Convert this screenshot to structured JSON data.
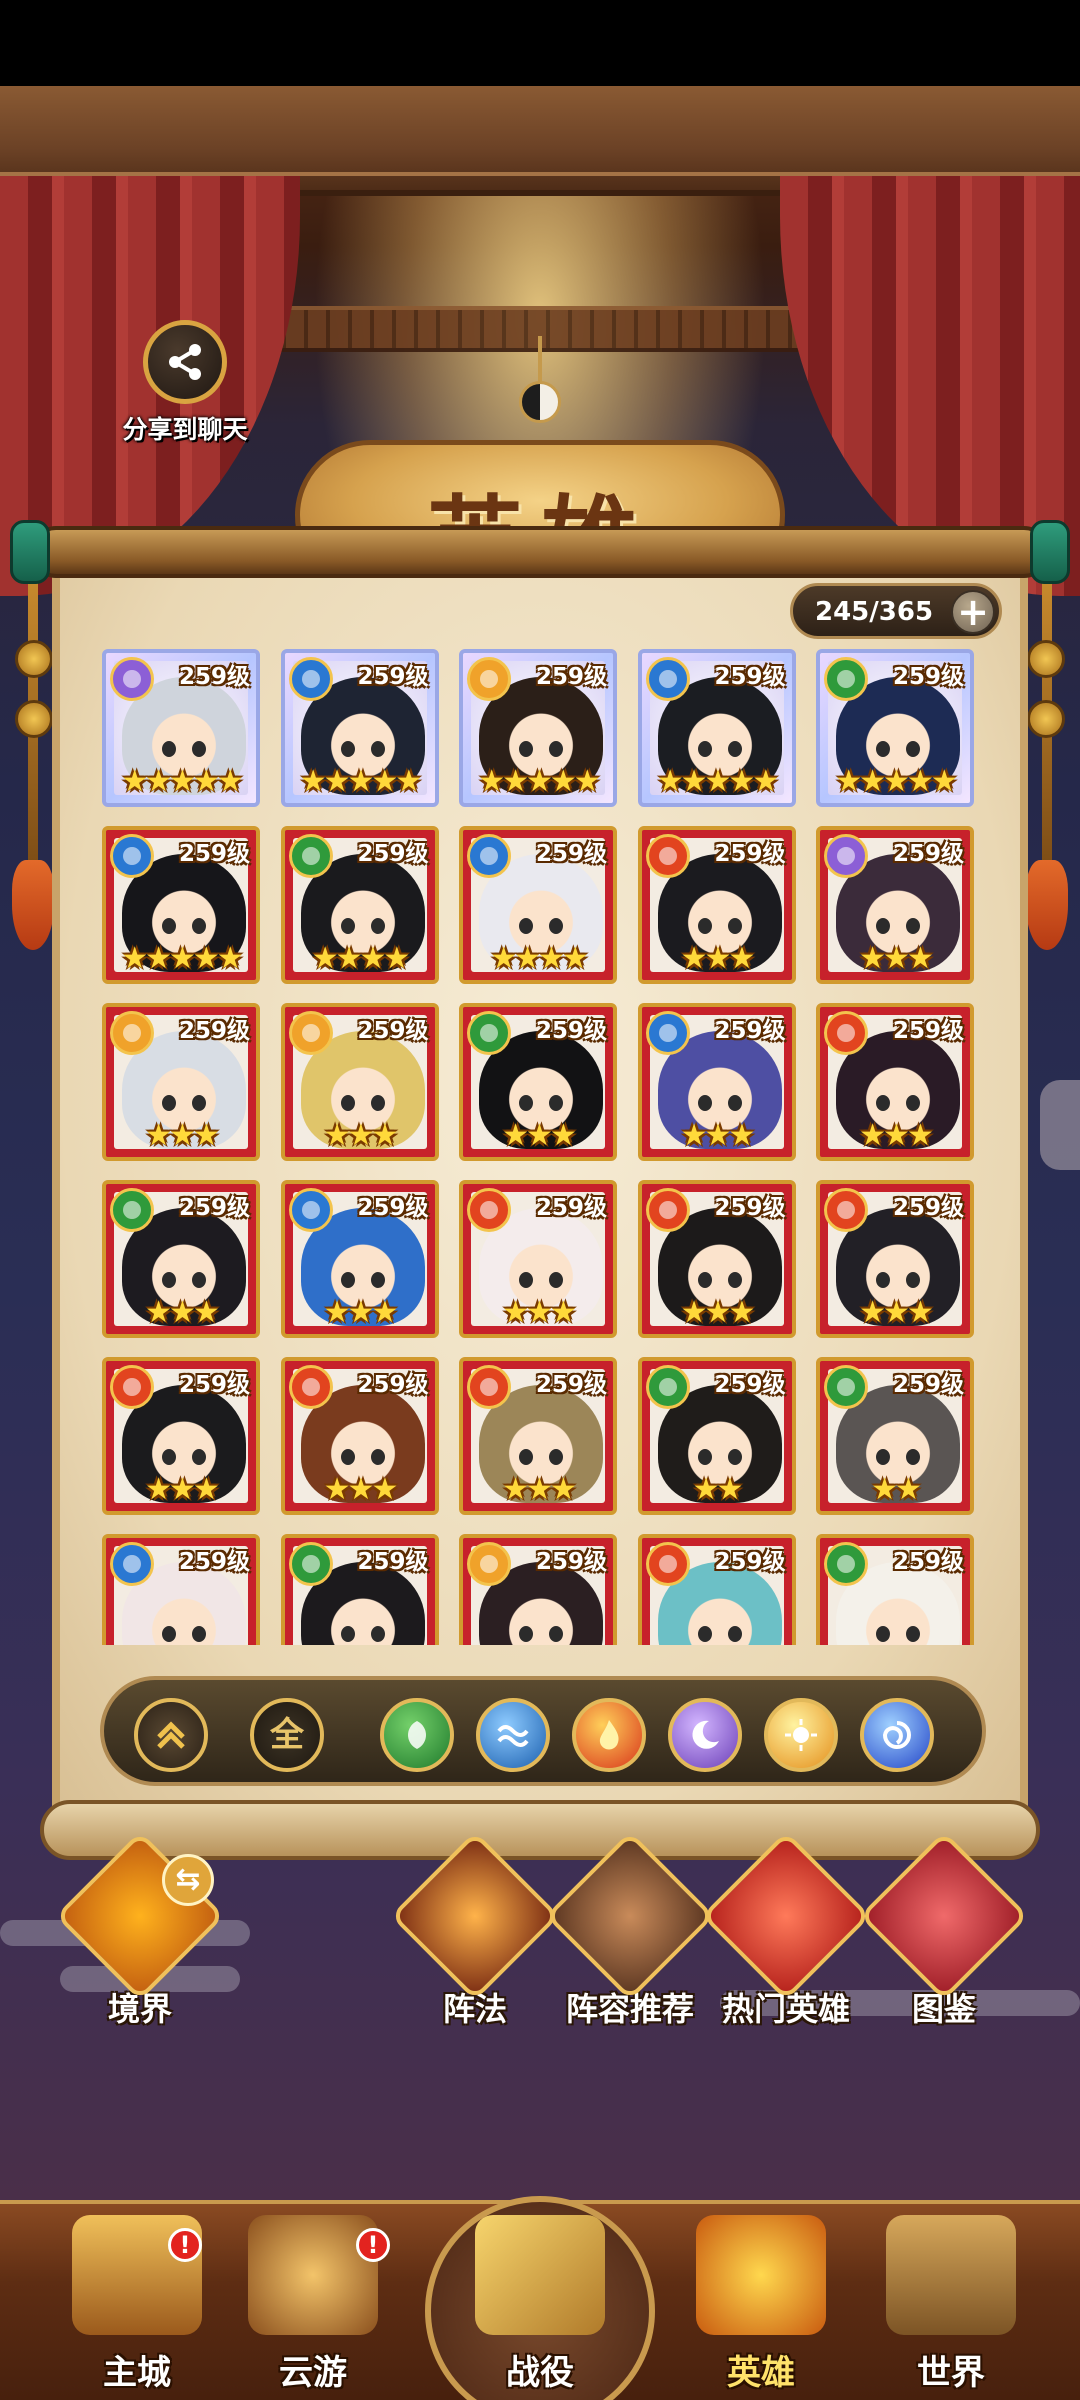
{
  "share": {
    "label": "分享到聊天",
    "icon": "share-icon"
  },
  "title": "英雄",
  "hero_count": {
    "text": "245/365",
    "plus": "+"
  },
  "hero_grid": {
    "level_text": "259级",
    "cards": [
      {
        "frame": "purple",
        "element": "dark",
        "stars": "★★★★★",
        "hair": "#cfd4dc"
      },
      {
        "frame": "purple",
        "element": "water",
        "stars": "★★★★★",
        "hair": "#1e2433"
      },
      {
        "frame": "purple",
        "element": "light",
        "stars": "★★★★★",
        "hair": "#2b1f18"
      },
      {
        "frame": "purple",
        "element": "water",
        "stars": "★★★★★",
        "hair": "#1b1d22"
      },
      {
        "frame": "purple",
        "element": "wood",
        "stars": "★★★★★",
        "hair": "#1d2b54"
      },
      {
        "frame": "red",
        "element": "water",
        "stars": "★★★★★",
        "hair": "#16161a"
      },
      {
        "frame": "red",
        "element": "wood",
        "stars": "★★★★",
        "hair": "#1a1a1d"
      },
      {
        "frame": "red",
        "element": "water",
        "stars": "★★★★",
        "hair": "#e9e9ef"
      },
      {
        "frame": "red",
        "element": "fire",
        "stars": "★★★",
        "hair": "#1b1b1f"
      },
      {
        "frame": "red",
        "element": "dark",
        "stars": "★★★",
        "hair": "#3b2b3a"
      },
      {
        "frame": "red",
        "element": "light",
        "stars": "★★★",
        "hair": "#d8dde4"
      },
      {
        "frame": "red",
        "element": "light",
        "stars": "★★★",
        "hair": "#e0c56a"
      },
      {
        "frame": "red",
        "element": "wood",
        "stars": "★★★",
        "hair": "#121214"
      },
      {
        "frame": "red",
        "element": "water",
        "stars": "★★★",
        "hair": "#4e4fa3"
      },
      {
        "frame": "red",
        "element": "fire",
        "stars": "★★★",
        "hair": "#2a1b26"
      },
      {
        "frame": "red",
        "element": "wood",
        "stars": "★★★",
        "hair": "#1d1b20"
      },
      {
        "frame": "red",
        "element": "water",
        "stars": "★★★",
        "hair": "#2f6fc9"
      },
      {
        "frame": "red",
        "element": "fire",
        "stars": "★★★",
        "hair": "#f4ecec"
      },
      {
        "frame": "red",
        "element": "fire",
        "stars": "★★★",
        "hair": "#1c1a1a"
      },
      {
        "frame": "red",
        "element": "fire",
        "stars": "★★★",
        "hair": "#222026"
      },
      {
        "frame": "red",
        "element": "fire",
        "stars": "★★★",
        "hair": "#1b1b1d"
      },
      {
        "frame": "red",
        "element": "fire",
        "stars": "★★★",
        "hair": "#7a3b1e"
      },
      {
        "frame": "red",
        "element": "fire",
        "stars": "★★★",
        "hair": "#9c8658"
      },
      {
        "frame": "red",
        "element": "wood",
        "stars": "★★",
        "hair": "#1f1c1a"
      },
      {
        "frame": "red",
        "element": "wood",
        "stars": "★★",
        "hair": "#5a5553"
      },
      {
        "frame": "red",
        "element": "water",
        "stars": "",
        "hair": "#f1e6e6"
      },
      {
        "frame": "red",
        "element": "wood",
        "stars": "",
        "hair": "#1c1a1d"
      },
      {
        "frame": "red",
        "element": "light",
        "stars": "",
        "hair": "#2b1f22"
      },
      {
        "frame": "red",
        "element": "fire",
        "stars": "",
        "hair": "#6cc0c6"
      },
      {
        "frame": "red",
        "element": "wood",
        "stars": "",
        "hair": "#f4f1ea"
      }
    ]
  },
  "filters": {
    "all_label": "全",
    "element_colors": {
      "wood": "#2f9a3b",
      "water": "#2a78d2",
      "fire": "#e2441f",
      "dark": "#8c5fd6",
      "light": "#f0a22a"
    }
  },
  "features": {
    "realm": "境界",
    "formation": "阵法",
    "lineup": "阵容推荐",
    "hot_heroes": "热门英雄",
    "codex": "图鉴"
  },
  "nav": {
    "main_city": "主城",
    "travel": "云游",
    "battle": "战役",
    "heroes": "英雄",
    "world": "世界",
    "badge": "!"
  }
}
